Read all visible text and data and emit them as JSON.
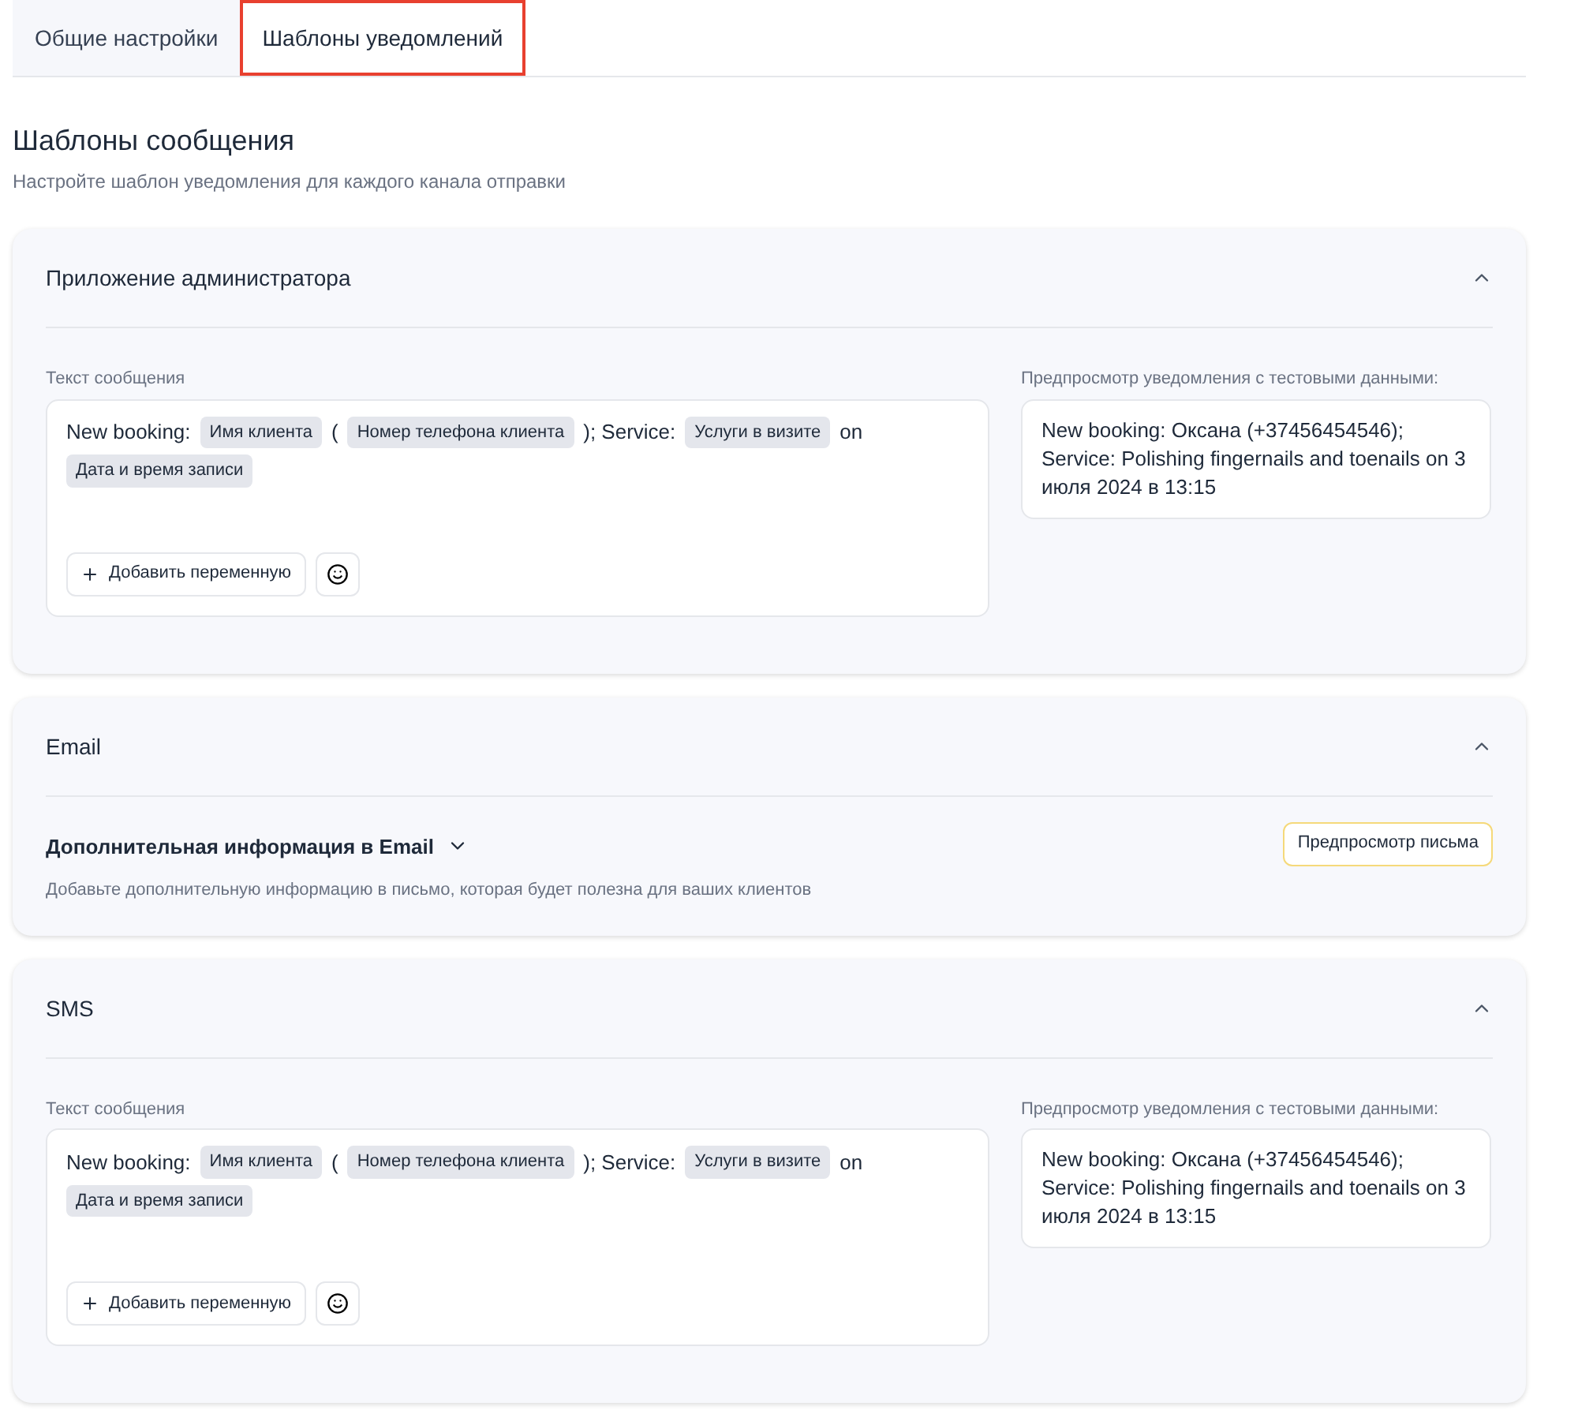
{
  "tabs": [
    {
      "label": "Общие настройки",
      "selected": false
    },
    {
      "label": "Шаблоны уведомлений",
      "selected": true
    }
  ],
  "heading": "Шаблоны сообщения",
  "subheading": "Настройте шаблон уведомления для каждого канала отправки",
  "cards": [
    {
      "kind": "template",
      "title": "Приложение администратора",
      "expanded": true,
      "editor_label": "Текст сообщения",
      "segments": [
        {
          "kind": "text",
          "text": "New booking:"
        },
        {
          "kind": "variable",
          "text": "Имя клиента"
        },
        {
          "kind": "text",
          "text": "("
        },
        {
          "kind": "variable",
          "text": "Номер телефона клиента"
        },
        {
          "kind": "text",
          "text": "); Service:"
        },
        {
          "kind": "variable",
          "text": "Услуги в визите"
        },
        {
          "kind": "text",
          "text": "on"
        },
        {
          "kind": "variable",
          "text": "Дата и время записи"
        }
      ],
      "add_button": "Добавить переменную",
      "preview_label": "Предпросмотр уведомления с тестовыми данными:",
      "preview": "New booking: Оксана (+37456454546); Service: Polishing fingernails and toenails on 3 июля 2024 в 13:15"
    },
    {
      "kind": "email",
      "title": "Email",
      "expanded": true,
      "section_title": "Дополнительная информация в Email",
      "section_expanded": false,
      "section_hint": "Добавьте дополнительную информацию в письмо, которая будет полезна для ваших клиентов",
      "preview_button": "Предпросмотр письма"
    },
    {
      "kind": "template",
      "title": "SMS",
      "expanded": true,
      "editor_label": "Текст сообщения",
      "segments": [
        {
          "kind": "text",
          "text": "New booking:"
        },
        {
          "kind": "variable",
          "text": "Имя клиента"
        },
        {
          "kind": "text",
          "text": "("
        },
        {
          "kind": "variable",
          "text": "Номер телефона клиента"
        },
        {
          "kind": "text",
          "text": "); Service:"
        },
        {
          "kind": "variable",
          "text": "Услуги в визите"
        },
        {
          "kind": "text",
          "text": "on"
        },
        {
          "kind": "variable",
          "text": "Дата и время записи"
        }
      ],
      "add_button": "Добавить переменную",
      "preview_label": "Предпросмотр уведомления с тестовыми данными:",
      "preview": "New booking: Оксана (+37456454546); Service: Polishing fingernails and toenails on 3 июля 2024 в 13:15"
    }
  ]
}
